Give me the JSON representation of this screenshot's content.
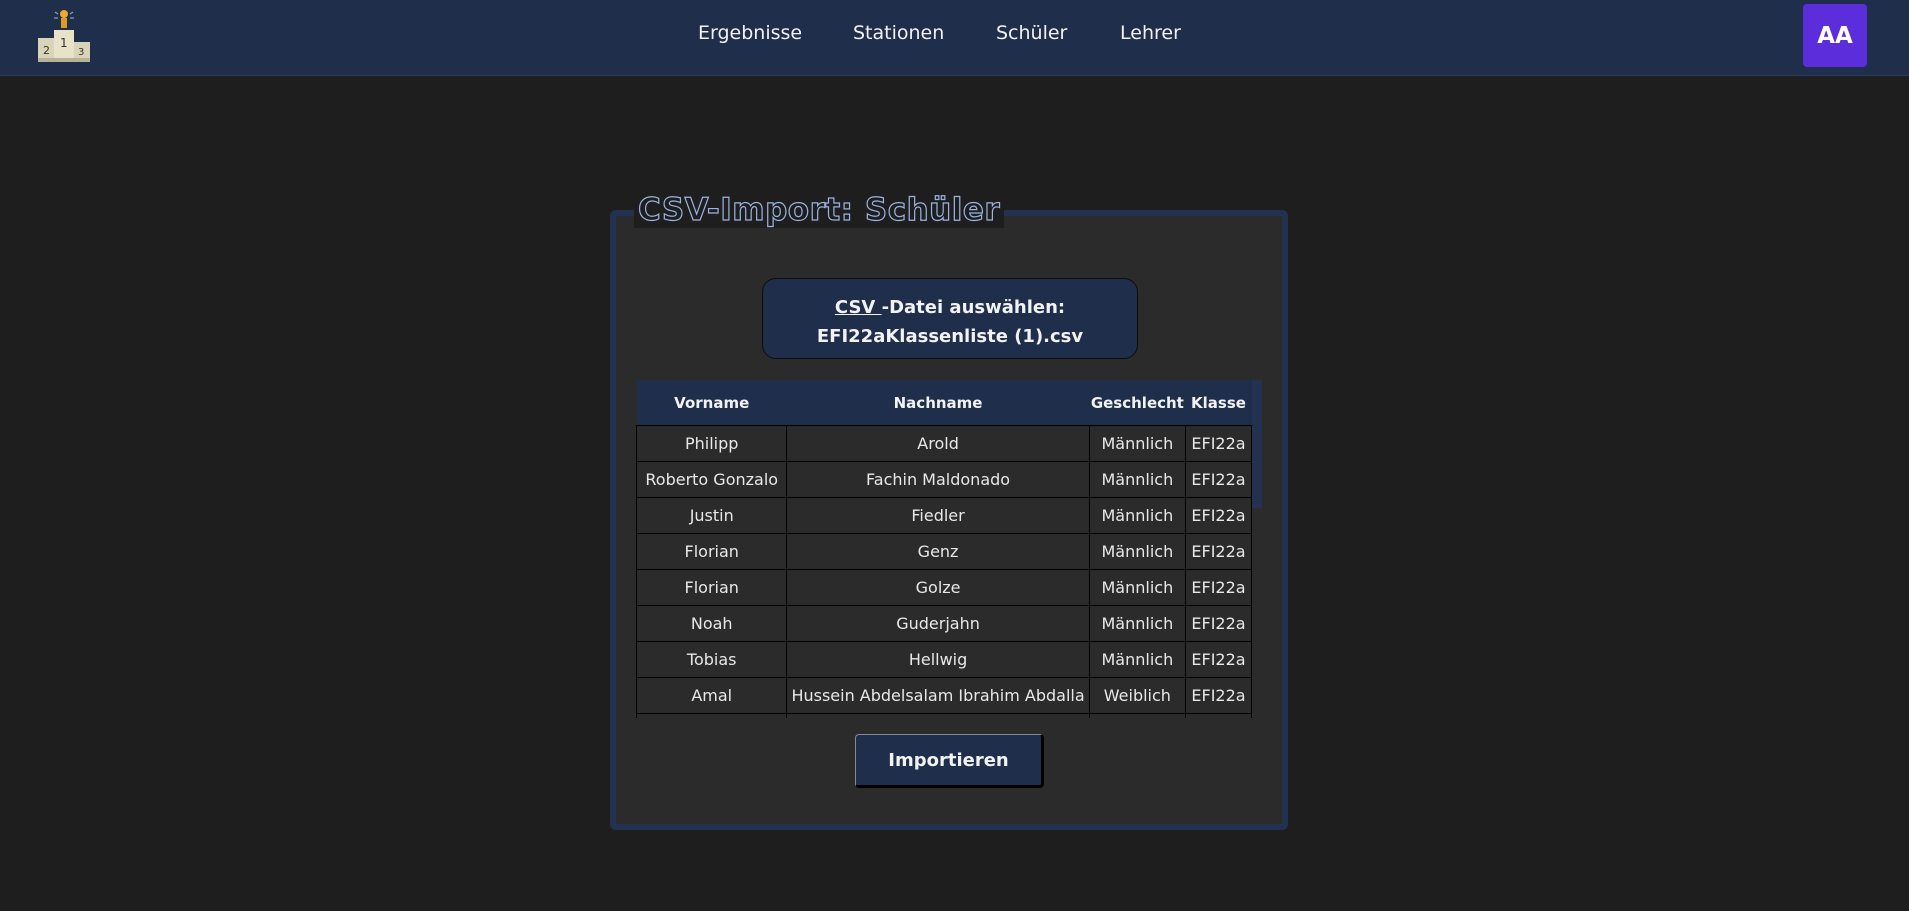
{
  "nav": {
    "items": [
      {
        "label": "Ergebnisse"
      },
      {
        "label": "Stationen"
      },
      {
        "label": "Schüler"
      },
      {
        "label": "Lehrer"
      }
    ],
    "avatar_initials": "AA",
    "logo_icon": "podium-icon"
  },
  "card": {
    "title": "CSV-Import: Schüler",
    "file_button": {
      "csv_label": "CSV ",
      "rest_label": "-Datei auswählen:",
      "filename": "EFI22aKlassenliste (1).csv"
    },
    "import_label": "Importieren"
  },
  "table": {
    "headers": [
      "Vorname",
      "Nachname",
      "Geschlecht",
      "Klasse"
    ],
    "rows": [
      [
        "Philipp",
        "Arold",
        "Männlich",
        "EFI22a"
      ],
      [
        "Roberto Gonzalo",
        "Fachin Maldonado",
        "Männlich",
        "EFI22a"
      ],
      [
        "Justin",
        "Fiedler",
        "Männlich",
        "EFI22a"
      ],
      [
        "Florian",
        "Genz",
        "Männlich",
        "EFI22a"
      ],
      [
        "Florian",
        "Golze",
        "Männlich",
        "EFI22a"
      ],
      [
        "Noah",
        "Guderjahn",
        "Männlich",
        "EFI22a"
      ],
      [
        "Tobias",
        "Hellwig",
        "Männlich",
        "EFI22a"
      ],
      [
        "Amal",
        "Hussein Abdelsalam Ibrahim Abdalla",
        "Weiblich",
        "EFI22a"
      ]
    ]
  },
  "colors": {
    "navbar": "#1f2e4a",
    "background": "#1e1e1e",
    "card": "#2b2b2b",
    "avatar": "#5b2ddb"
  }
}
